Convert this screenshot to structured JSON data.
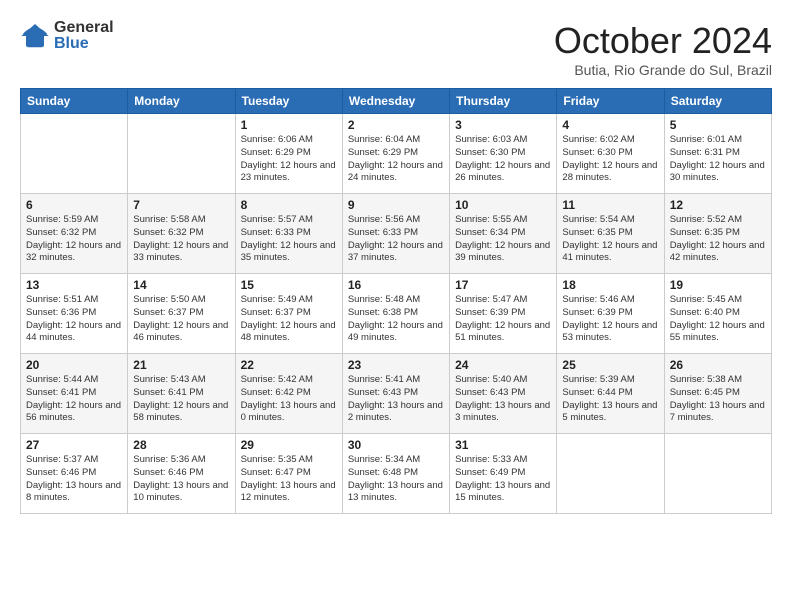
{
  "header": {
    "logo": {
      "general": "General",
      "blue": "Blue"
    },
    "title": "October 2024",
    "location": "Butia, Rio Grande do Sul, Brazil"
  },
  "days_of_week": [
    "Sunday",
    "Monday",
    "Tuesday",
    "Wednesday",
    "Thursday",
    "Friday",
    "Saturday"
  ],
  "weeks": [
    [
      {
        "day": "",
        "info": ""
      },
      {
        "day": "",
        "info": ""
      },
      {
        "day": "1",
        "info": "Sunrise: 6:06 AM\nSunset: 6:29 PM\nDaylight: 12 hours and 23 minutes."
      },
      {
        "day": "2",
        "info": "Sunrise: 6:04 AM\nSunset: 6:29 PM\nDaylight: 12 hours and 24 minutes."
      },
      {
        "day": "3",
        "info": "Sunrise: 6:03 AM\nSunset: 6:30 PM\nDaylight: 12 hours and 26 minutes."
      },
      {
        "day": "4",
        "info": "Sunrise: 6:02 AM\nSunset: 6:30 PM\nDaylight: 12 hours and 28 minutes."
      },
      {
        "day": "5",
        "info": "Sunrise: 6:01 AM\nSunset: 6:31 PM\nDaylight: 12 hours and 30 minutes."
      }
    ],
    [
      {
        "day": "6",
        "info": "Sunrise: 5:59 AM\nSunset: 6:32 PM\nDaylight: 12 hours and 32 minutes."
      },
      {
        "day": "7",
        "info": "Sunrise: 5:58 AM\nSunset: 6:32 PM\nDaylight: 12 hours and 33 minutes."
      },
      {
        "day": "8",
        "info": "Sunrise: 5:57 AM\nSunset: 6:33 PM\nDaylight: 12 hours and 35 minutes."
      },
      {
        "day": "9",
        "info": "Sunrise: 5:56 AM\nSunset: 6:33 PM\nDaylight: 12 hours and 37 minutes."
      },
      {
        "day": "10",
        "info": "Sunrise: 5:55 AM\nSunset: 6:34 PM\nDaylight: 12 hours and 39 minutes."
      },
      {
        "day": "11",
        "info": "Sunrise: 5:54 AM\nSunset: 6:35 PM\nDaylight: 12 hours and 41 minutes."
      },
      {
        "day": "12",
        "info": "Sunrise: 5:52 AM\nSunset: 6:35 PM\nDaylight: 12 hours and 42 minutes."
      }
    ],
    [
      {
        "day": "13",
        "info": "Sunrise: 5:51 AM\nSunset: 6:36 PM\nDaylight: 12 hours and 44 minutes."
      },
      {
        "day": "14",
        "info": "Sunrise: 5:50 AM\nSunset: 6:37 PM\nDaylight: 12 hours and 46 minutes."
      },
      {
        "day": "15",
        "info": "Sunrise: 5:49 AM\nSunset: 6:37 PM\nDaylight: 12 hours and 48 minutes."
      },
      {
        "day": "16",
        "info": "Sunrise: 5:48 AM\nSunset: 6:38 PM\nDaylight: 12 hours and 49 minutes."
      },
      {
        "day": "17",
        "info": "Sunrise: 5:47 AM\nSunset: 6:39 PM\nDaylight: 12 hours and 51 minutes."
      },
      {
        "day": "18",
        "info": "Sunrise: 5:46 AM\nSunset: 6:39 PM\nDaylight: 12 hours and 53 minutes."
      },
      {
        "day": "19",
        "info": "Sunrise: 5:45 AM\nSunset: 6:40 PM\nDaylight: 12 hours and 55 minutes."
      }
    ],
    [
      {
        "day": "20",
        "info": "Sunrise: 5:44 AM\nSunset: 6:41 PM\nDaylight: 12 hours and 56 minutes."
      },
      {
        "day": "21",
        "info": "Sunrise: 5:43 AM\nSunset: 6:41 PM\nDaylight: 12 hours and 58 minutes."
      },
      {
        "day": "22",
        "info": "Sunrise: 5:42 AM\nSunset: 6:42 PM\nDaylight: 13 hours and 0 minutes."
      },
      {
        "day": "23",
        "info": "Sunrise: 5:41 AM\nSunset: 6:43 PM\nDaylight: 13 hours and 2 minutes."
      },
      {
        "day": "24",
        "info": "Sunrise: 5:40 AM\nSunset: 6:43 PM\nDaylight: 13 hours and 3 minutes."
      },
      {
        "day": "25",
        "info": "Sunrise: 5:39 AM\nSunset: 6:44 PM\nDaylight: 13 hours and 5 minutes."
      },
      {
        "day": "26",
        "info": "Sunrise: 5:38 AM\nSunset: 6:45 PM\nDaylight: 13 hours and 7 minutes."
      }
    ],
    [
      {
        "day": "27",
        "info": "Sunrise: 5:37 AM\nSunset: 6:46 PM\nDaylight: 13 hours and 8 minutes."
      },
      {
        "day": "28",
        "info": "Sunrise: 5:36 AM\nSunset: 6:46 PM\nDaylight: 13 hours and 10 minutes."
      },
      {
        "day": "29",
        "info": "Sunrise: 5:35 AM\nSunset: 6:47 PM\nDaylight: 13 hours and 12 minutes."
      },
      {
        "day": "30",
        "info": "Sunrise: 5:34 AM\nSunset: 6:48 PM\nDaylight: 13 hours and 13 minutes."
      },
      {
        "day": "31",
        "info": "Sunrise: 5:33 AM\nSunset: 6:49 PM\nDaylight: 13 hours and 15 minutes."
      },
      {
        "day": "",
        "info": ""
      },
      {
        "day": "",
        "info": ""
      }
    ]
  ]
}
